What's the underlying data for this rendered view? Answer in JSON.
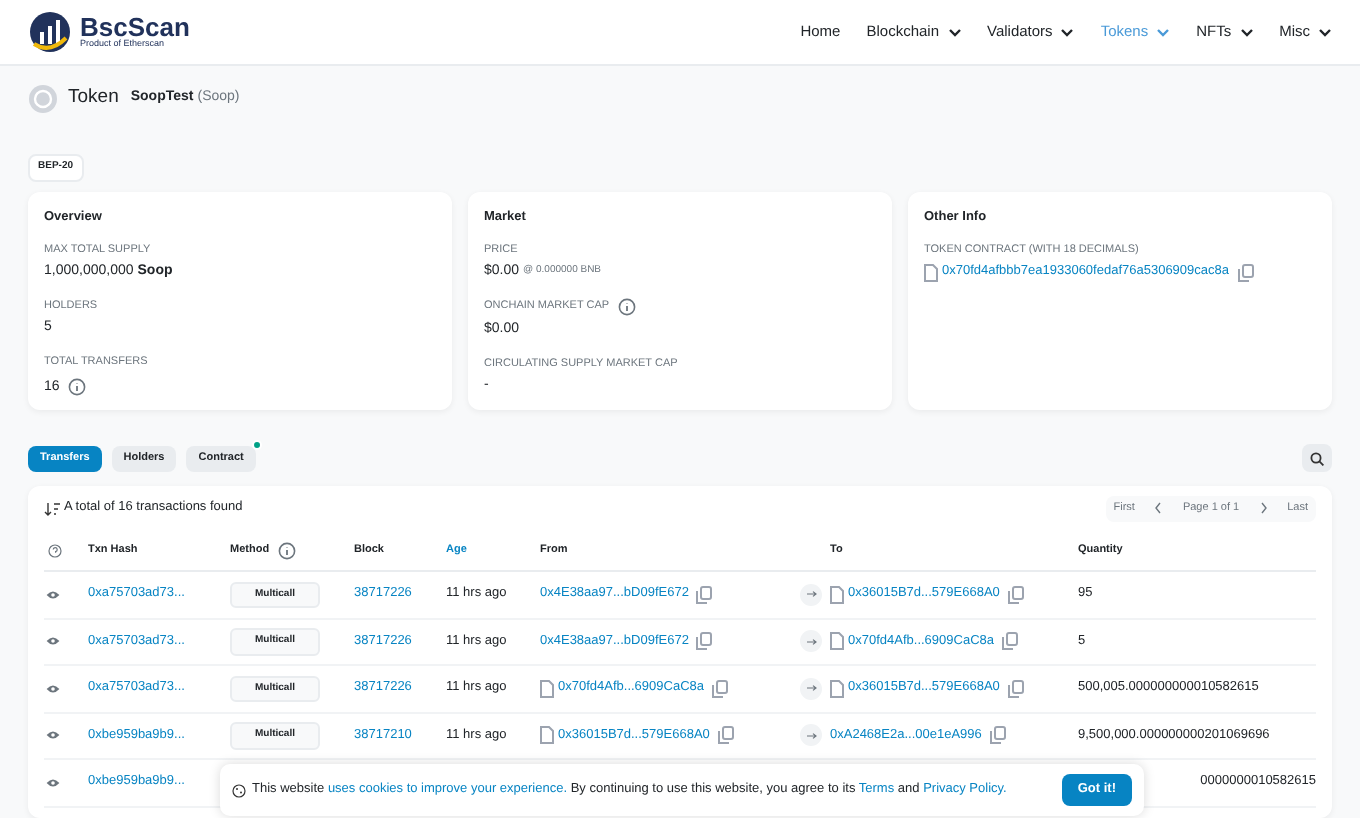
{
  "nav": {
    "logo": "BscScan",
    "logo_sub": "Product of Etherscan",
    "items": [
      {
        "label": "Home",
        "dropdown": false,
        "selected": false
      },
      {
        "label": "Blockchain",
        "dropdown": true,
        "selected": false
      },
      {
        "label": "Validators",
        "dropdown": true,
        "selected": false
      },
      {
        "label": "Tokens",
        "dropdown": true,
        "selected": true
      },
      {
        "label": "NFTs",
        "dropdown": true,
        "selected": false
      },
      {
        "label": "Misc",
        "dropdown": true,
        "selected": false
      }
    ]
  },
  "header": {
    "title": "Token",
    "name": "SoopTest",
    "symbol": "(Soop)",
    "badge": "BEP-20"
  },
  "cards": [
    {
      "title": "Overview",
      "fields": [
        {
          "label": "MAX TOTAL SUPPLY",
          "value": "1,000,000,000",
          "suffix": "Soop",
          "info": false
        },
        {
          "label": "HOLDERS",
          "value": "5",
          "info": false
        },
        {
          "label": "TOTAL TRANSFERS",
          "value": "16",
          "info": true
        }
      ]
    },
    {
      "title": "Market",
      "fields": [
        {
          "label": "PRICE",
          "value": "$0.00",
          "note": "@ 0.000000 BNB",
          "info": false
        },
        {
          "label": "ONCHAIN MARKET CAP",
          "value": "$0.00",
          "label_info": true,
          "info": false
        },
        {
          "label": "CIRCULATING SUPPLY MARKET CAP",
          "value": "-",
          "info": false
        }
      ]
    },
    {
      "title": "Other Info",
      "fields": [
        {
          "label": "TOKEN CONTRACT (WITH 18 DECIMALS)",
          "link": "0x70fd4afbbb7ea1933060fedaf76a5306909cac8a",
          "info": false
        }
      ]
    }
  ],
  "tabs": [
    {
      "label": "Transfers",
      "selected": true,
      "dot": false
    },
    {
      "label": "Holders",
      "selected": false,
      "dot": false
    },
    {
      "label": "Contract",
      "selected": false,
      "dot": true
    }
  ],
  "summary": "A total of 16 transactions found",
  "pagination": {
    "first": "First",
    "page": "Page 1 of 1",
    "last": "Last"
  },
  "table": {
    "columns": [
      "Txn Hash",
      "Method",
      "Block",
      "Age",
      "From",
      "To",
      "Quantity"
    ],
    "rows": [
      {
        "hash": "0xa75703ad73...",
        "method": "Multicall",
        "block": "38717226",
        "age": "11 hrs ago",
        "from": "0x4E38aa97...bD09fE672",
        "from_contract": false,
        "to": "0x36015B7d...579E668A0",
        "to_contract": true,
        "quantity": "95"
      },
      {
        "hash": "0xa75703ad73...",
        "method": "Multicall",
        "block": "38717226",
        "age": "11 hrs ago",
        "from": "0x4E38aa97...bD09fE672",
        "from_contract": false,
        "to": "0x70fd4Afb...6909CaC8a",
        "to_contract": true,
        "quantity": "5"
      },
      {
        "hash": "0xa75703ad73...",
        "method": "Multicall",
        "block": "38717226",
        "age": "11 hrs ago",
        "from": "0x70fd4Afb...6909CaC8a",
        "from_contract": true,
        "to": "0x36015B7d...579E668A0",
        "to_contract": true,
        "quantity": "500,005.000000000010582615"
      },
      {
        "hash": "0xbe959ba9b9...",
        "method": "Multicall",
        "block": "38717210",
        "age": "11 hrs ago",
        "from": "0x36015B7d...579E668A0",
        "from_contract": true,
        "to": "0xA2468E2a...00e1eA996",
        "to_contract": false,
        "quantity": "9,500,000.000000000201069696"
      },
      {
        "hash": "0xbe959ba9b9...",
        "quantity": "0000000010582615"
      }
    ]
  },
  "cookie": {
    "text1": "This website",
    "link1": "uses cookies to improve your experience.",
    "text2": "By continuing to use this website, you agree to its",
    "link2": "Terms",
    "text3": "and",
    "link3": "Privacy Policy.",
    "button": "Got it!"
  }
}
